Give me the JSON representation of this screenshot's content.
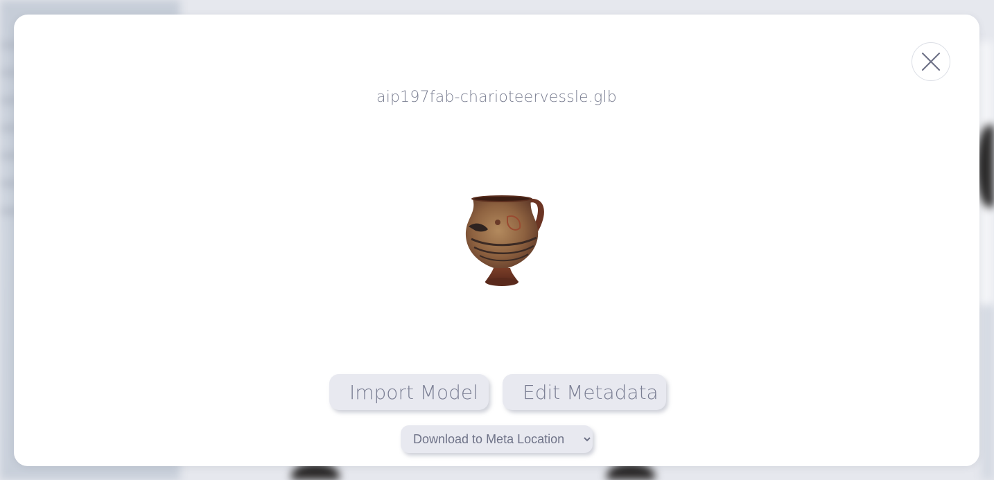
{
  "modal": {
    "file_name": "aip197fab-charioteervessle.glb",
    "close_icon": "close-icon",
    "preview_icon": "vessel-model-preview"
  },
  "actions": {
    "import_label": "Import Model",
    "edit_label": "Edit Metadata"
  },
  "download": {
    "selected": "Download to Meta Location",
    "options": [
      "Download to Meta Location"
    ]
  },
  "colors": {
    "modal_bg": "#ffffff",
    "button_bg": "#e8e9f0",
    "text": "#7a7e93",
    "backdrop": "#e6e8ee"
  }
}
